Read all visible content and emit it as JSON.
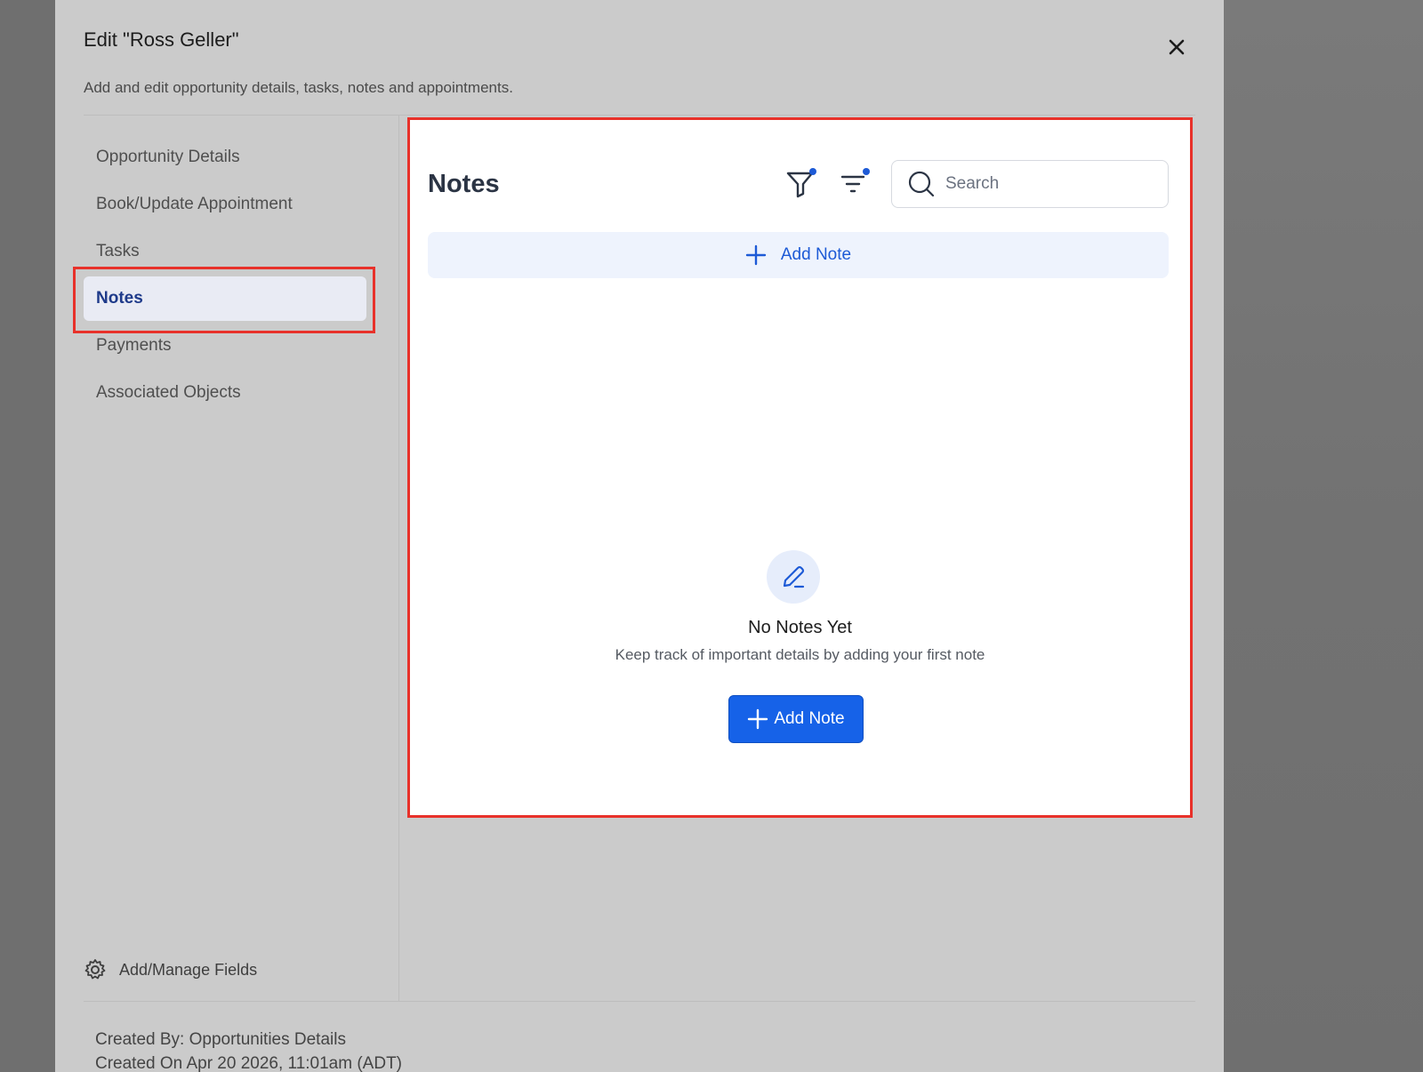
{
  "modal": {
    "title": "Edit \"Ross Geller\"",
    "subtitle": "Add and edit opportunity details, tasks, notes and appointments."
  },
  "sidebar": {
    "items": [
      {
        "label": "Opportunity Details"
      },
      {
        "label": "Book/Update Appointment"
      },
      {
        "label": "Tasks"
      },
      {
        "label": "Notes",
        "active": true
      },
      {
        "label": "Payments"
      },
      {
        "label": "Associated Objects"
      }
    ],
    "manage_fields_label": "Add/Manage Fields"
  },
  "notes": {
    "title": "Notes",
    "search_placeholder": "Search",
    "add_note_bar_label": "Add Note",
    "empty": {
      "title": "No Notes Yet",
      "description": "Keep track of important details by adding your first note",
      "button_label": "Add Note"
    }
  },
  "footer": {
    "created_by": "Created By: Opportunities Details",
    "created_on": "Created On Apr 20 2026, 11:01am (ADT)"
  },
  "colors": {
    "accent": "#1662e8",
    "highlight": "#e8312a",
    "active_nav_text": "#1e3a8a",
    "dot": "#1d5ad6"
  },
  "icons": {
    "close": "close-icon",
    "filter": "filter-icon",
    "sort": "sort-icon",
    "search": "search-icon",
    "plus": "plus-icon",
    "pen": "pen-icon",
    "gear": "gear-icon"
  }
}
